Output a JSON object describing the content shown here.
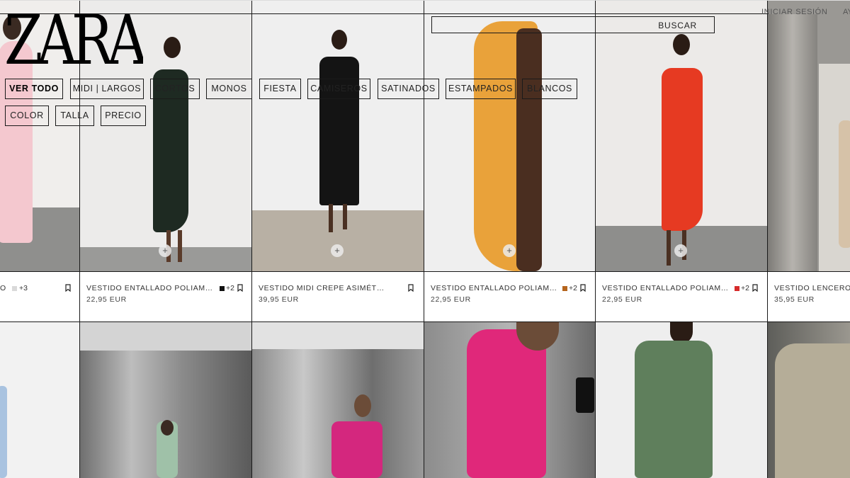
{
  "header": {
    "logo": "ZARA",
    "search_label": "BUSCAR",
    "login": "INICIAR SESIÓN",
    "cart_partial": "AY"
  },
  "categories": [
    "VER TODO",
    "MIDI | LARGOS",
    "CORTOS",
    "MONOS",
    "FIESTA",
    "CAMISEROS",
    "SATINADOS",
    "ESTAMPADOS",
    "BLANCOS"
  ],
  "filters": [
    "COLOR",
    "TALLA",
    "PRECIO"
  ],
  "colors": {
    "grid_line": "#1a1a1a",
    "text": "#222222"
  },
  "products_row1": [
    {
      "name": "O",
      "price": "",
      "more": "+3",
      "swatch": "#d9d9d9",
      "icon": "bookmark-icon"
    },
    {
      "name": "VESTIDO ENTALLADO POLIAMIDA...",
      "price": "22,95 EUR",
      "more": "+2",
      "swatch": "#111111",
      "icon": "bookmark-icon"
    },
    {
      "name": "VESTIDO MIDI CREPE ASIMÉTRICO",
      "price": "39,95 EUR",
      "more": "",
      "swatch": "",
      "icon": "bookmark-icon"
    },
    {
      "name": "VESTIDO ENTALLADO POLIAMIDA...",
      "price": "22,95 EUR",
      "more": "+2",
      "swatch": "#b5651d",
      "icon": "bookmark-icon"
    },
    {
      "name": "VESTIDO ENTALLADO POLIAMIDA...",
      "price": "22,95 EUR",
      "more": "+2",
      "swatch": "#d62b2b",
      "icon": "bookmark-icon"
    },
    {
      "name": "VESTIDO LENCERO TI",
      "price": "35,95 EUR",
      "more": "",
      "swatch": "",
      "icon": "bookmark-icon"
    }
  ],
  "quick_add": "+"
}
